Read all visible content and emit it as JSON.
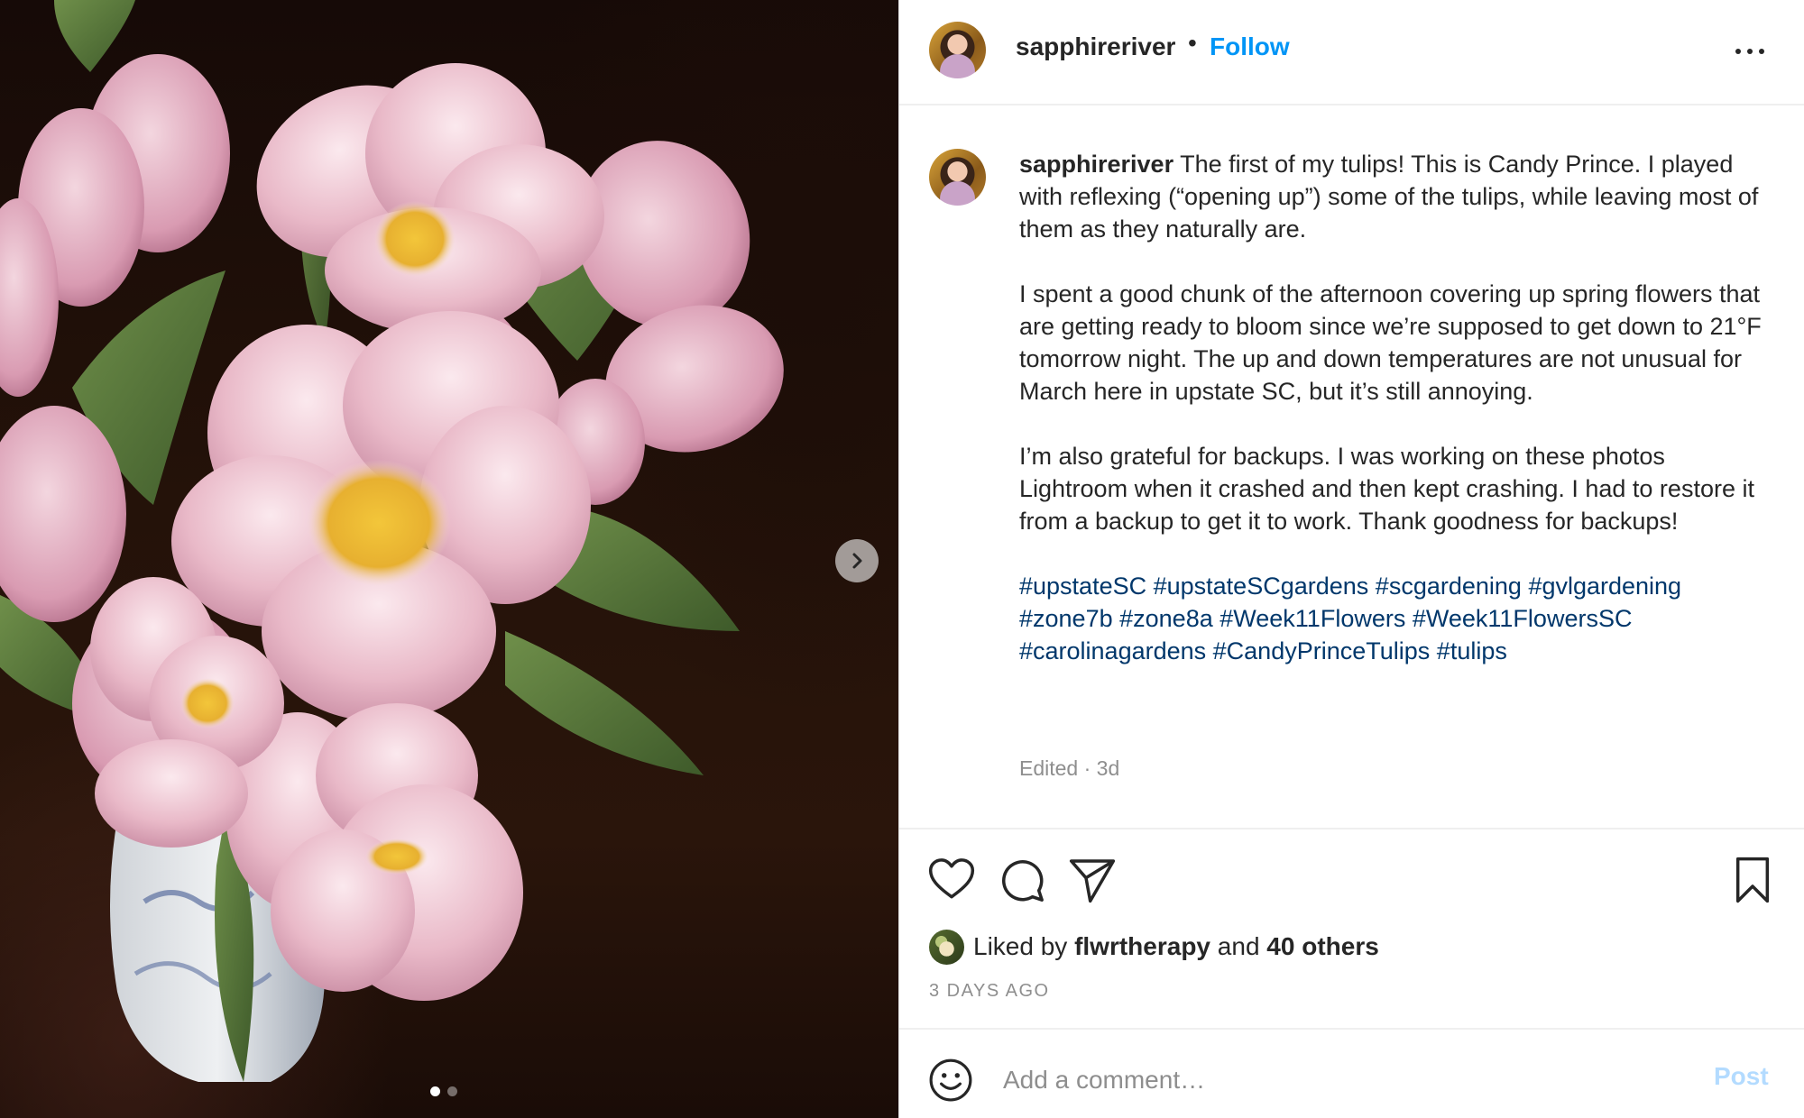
{
  "photo": {
    "alt": "Pink Candy Prince tulips in a blue and white vase on a dark background",
    "current_slide": 1,
    "slide_count": 2,
    "next_icon": "chevron-right-icon"
  },
  "header": {
    "username": "sapphireriver",
    "separator": "•",
    "follow_label": "Follow",
    "more_icon": "more-horizontal-icon"
  },
  "caption": {
    "username": "sapphireriver",
    "paragraphs": [
      " The first of my tulips! This is Candy Prince. I played with reflexing (“opening up”) some of the tulips, while leaving most of them as they naturally are.",
      "I spent a good chunk of the afternoon covering up spring flowers that are getting ready to bloom since we’re supposed to get down to 21°F tomorrow night. The up and down temperatures are not unusual for March here in upstate SC, but it’s still annoying.",
      "I’m also grateful for backups. I was working on these photos Lightroom when it crashed and then kept crashing. I had to restore it from a backup to get it to work. Thank goodness for backups!"
    ],
    "hashtags": [
      "#upstateSC",
      "#upstateSCgardens",
      "#scgardening",
      "#gvlgardening",
      "#zone7b",
      "#zone8a",
      "#Week11Flowers",
      "#Week11FlowersSC",
      "#carolinagardens",
      "#CandyPrinceTulips",
      "#tulips"
    ],
    "meta": "Edited · 3d"
  },
  "actions": {
    "like_icon": "heart-icon",
    "comment_icon": "comment-icon",
    "share_icon": "send-icon",
    "save_icon": "bookmark-icon"
  },
  "likes": {
    "prefix": "Liked by",
    "user": "flwrtherapy",
    "middle": "and",
    "others": "40 others"
  },
  "timeago": "3 DAYS AGO",
  "comment": {
    "emoji_icon": "smiley-icon",
    "placeholder": "Add a comment…",
    "post_label": "Post"
  },
  "colors": {
    "link_blue": "#0095f6",
    "hashtag": "#00376b",
    "muted": "#8e8e8e",
    "post_disabled": "#b3dbff"
  }
}
